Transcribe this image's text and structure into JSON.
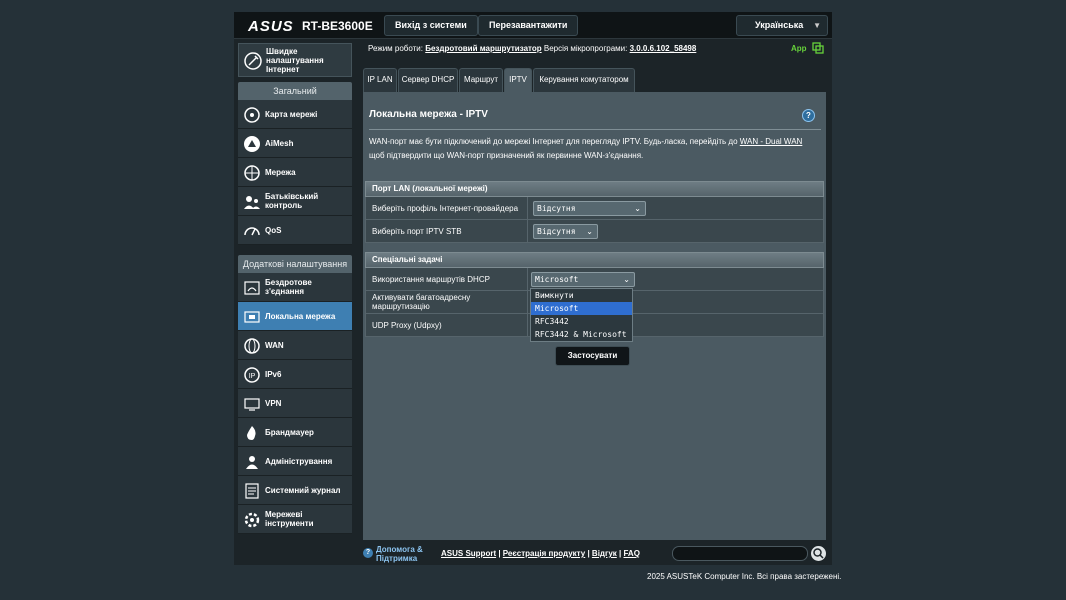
{
  "header": {
    "brand": "ASUS",
    "model": "RT-BE3600E",
    "logout_label": "Вихід з системи",
    "reboot_label": "Перезавантажити",
    "language": "Українська"
  },
  "sidebar": {
    "quick_setup": "Швидке налаштування Інтернет",
    "general_title": "Загальний",
    "general_items": [
      {
        "label": "Карта мережі",
        "icon": "network-map-icon"
      },
      {
        "label": "AiMesh",
        "icon": "aimesh-icon"
      },
      {
        "label": "Мережа",
        "icon": "globe-icon"
      },
      {
        "label": "Батьківський контроль",
        "icon": "parental-icon"
      },
      {
        "label": "QoS",
        "icon": "speedometer-icon"
      }
    ],
    "advanced_title": "Додаткові налаштування",
    "advanced_items": [
      {
        "label": "Бездротове з'єднання",
        "icon": "wifi-icon"
      },
      {
        "label": "Локальна мережа",
        "icon": "lan-icon",
        "active": true
      },
      {
        "label": "WAN",
        "icon": "wan-globe-icon"
      },
      {
        "label": "IPv6",
        "icon": "ipv6-icon"
      },
      {
        "label": "VPN",
        "icon": "vpn-icon"
      },
      {
        "label": "Брандмауер",
        "icon": "firewall-icon"
      },
      {
        "label": "Адміністрування",
        "icon": "admin-icon"
      },
      {
        "label": "Системний журнал",
        "icon": "log-icon"
      },
      {
        "label": "Мережеві інструменти",
        "icon": "tools-icon"
      }
    ]
  },
  "status": {
    "mode_prefix": "Режим роботи:",
    "mode_value": "Бездротовий маршрутизатор",
    "fw_prefix": "Версія мікропрограми:",
    "fw_value": "3.0.0.6.102_58498",
    "app_label": "App"
  },
  "tabs": [
    "IP LAN",
    "Сервер DHCP",
    "Маршрут",
    "IPTV",
    "Керування комутатором"
  ],
  "panel": {
    "title": "Локальна мережа - IPTV",
    "help": "?",
    "desc_part1": "WAN-порт має бути підключений до мережі Інтернет для перегляду IPTV. Будь-ласка, перейдіть до ",
    "desc_link": "WAN - Dual WAN",
    "desc_part2": " щоб підтвердити що WAN-порт призначений як первинне WAN-з'єднання.",
    "lan_port_title": "Порт LAN (локальної мережі)",
    "isp_profile_label": "Виберіть профіль Інтернет-провайдера",
    "isp_profile_value": "Відсутня",
    "iptv_stb_label": "Виберіть порт IPTV STB",
    "iptv_stb_value": "Відсутня",
    "special_title": "Спеціальні задачі",
    "dhcp_routes_label": "Використання маршрутів DHCP",
    "dhcp_routes_value": "Microsoft",
    "multicast_label": "Активувати багатоадресну маршрутизацію",
    "udpxy_label": "UDP Proxy (Udpxy)",
    "dropdown_options": [
      "Вимкнути",
      "Microsoft",
      "RFC3442",
      "RFC3442 & Microsoft"
    ],
    "apply_label": "Застосувати"
  },
  "footer": {
    "help_text": "Допомога & Підтримка",
    "link_support": "ASUS Support",
    "link_register": "Реєстрація продукту",
    "link_feedback": "Відгук",
    "link_faq": "FAQ",
    "copyright": "2025 ASUSTeK Computer Inc. Всі права застережені."
  }
}
